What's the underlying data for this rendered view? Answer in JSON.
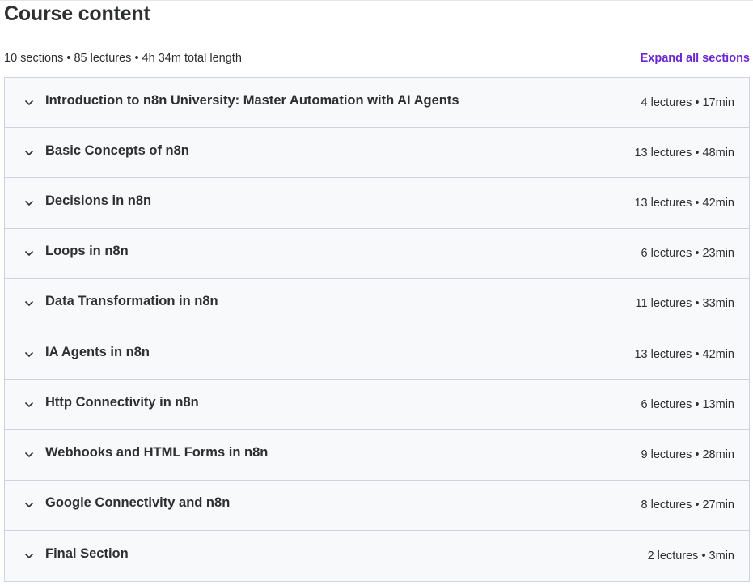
{
  "header": {
    "title": "Course content",
    "summary": "10 sections • 85 lectures • 4h 34m total length",
    "expand_all_label": "Expand all sections"
  },
  "colors": {
    "accent": "#6d28d2",
    "text": "#2d2f31",
    "section_bg": "#f7f9fa",
    "border": "#d1d2e0"
  },
  "sections": [
    {
      "title": "Introduction to n8n University: Master Automation with AI Agents",
      "meta": "4 lectures • 17min",
      "icon": "chevron-down-icon"
    },
    {
      "title": "Basic Concepts of n8n",
      "meta": "13 lectures • 48min",
      "icon": "chevron-down-icon"
    },
    {
      "title": "Decisions in n8n",
      "meta": "13 lectures • 42min",
      "icon": "chevron-down-icon"
    },
    {
      "title": "Loops in n8n",
      "meta": "6 lectures • 23min",
      "icon": "chevron-down-icon"
    },
    {
      "title": "Data Transformation in n8n",
      "meta": "11 lectures • 33min",
      "icon": "chevron-down-icon"
    },
    {
      "title": "IA Agents in n8n",
      "meta": "13 lectures • 42min",
      "icon": "chevron-down-icon"
    },
    {
      "title": "Http Connectivity in n8n",
      "meta": "6 lectures • 13min",
      "icon": "chevron-down-icon"
    },
    {
      "title": "Webhooks and HTML Forms in n8n",
      "meta": "9 lectures • 28min",
      "icon": "chevron-down-icon"
    },
    {
      "title": "Google Connectivity and n8n",
      "meta": "8 lectures • 27min",
      "icon": "chevron-down-icon"
    },
    {
      "title": "Final Section",
      "meta": "2 lectures • 3min",
      "icon": "chevron-down-icon"
    }
  ]
}
